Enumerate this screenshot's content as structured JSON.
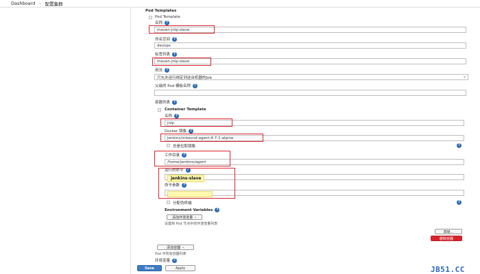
{
  "breadcrumb": {
    "home": "Dashboard",
    "current": "配置集群"
  },
  "pod_templates": {
    "heading": "Pod Templates",
    "pod_template_label": "Pod Template",
    "name_label": "名称",
    "name_value": "maven-jnlp-slave",
    "namespace_label": "命名空间",
    "namespace_value": "devops",
    "labels_label": "标签列表",
    "labels_value": "maven-jnlp-slave",
    "usage_label": "用法",
    "usage_value": "只允许运行绑定到这台机器的Job",
    "parent_label": "父级的 Pod 模板名称",
    "parent_value": "",
    "containers_label": "容器列表"
  },
  "container": {
    "heading": "Container Template",
    "name_label": "名称",
    "name_value": "jnlp",
    "image_label": "Docker 镜像",
    "image_value": "jenkins/inbound-agent:4.7-1-alpine",
    "always_pull_label": "总是拉取镜像",
    "workdir_label": "工作目录",
    "workdir_value": "/home/jenkins/agent",
    "command_label": "运行的命令",
    "command_value": "jenkins-slave",
    "args_label": "命令参数",
    "args_value": "",
    "tty_label": "分配伪终端",
    "env_heading": "Environment Variables",
    "add_env_button": "添加环境变量",
    "env_hint": "设置到 Pod 节点中的环境变量列表",
    "advanced_button": "高级...",
    "delete_button": "删除容器"
  },
  "footer": {
    "add_container_button": "添加容器",
    "containers_hint": "Pod 中所有容器列表",
    "env_label": "环境变量",
    "save_button": "Save",
    "apply_button": "Apply"
  },
  "watermark": "JB51.CC",
  "colors": {
    "accent": "#3e7bc4",
    "highlight_box": "#d9232c",
    "help_icon": "#2a6ab6"
  }
}
